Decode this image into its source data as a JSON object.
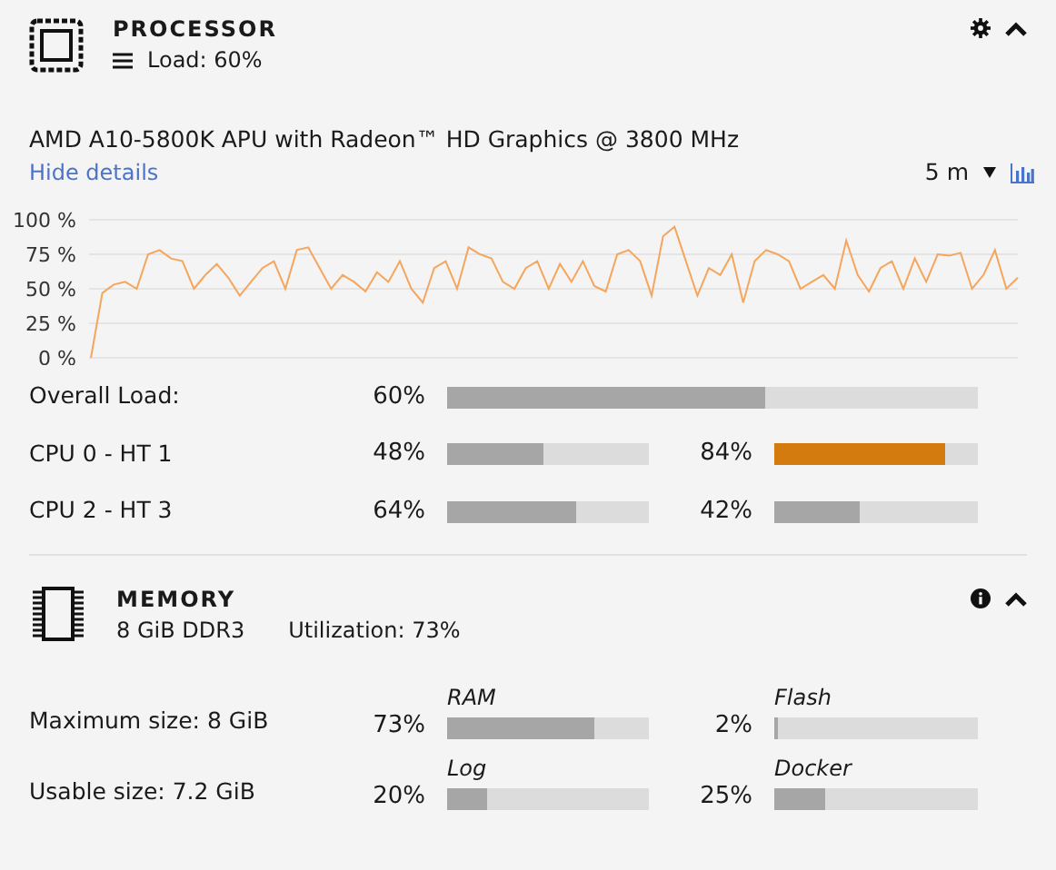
{
  "processor": {
    "title": "PROCESSOR",
    "load": "Load: 60%",
    "model": "AMD A10-5800K APU with Radeon™ HD Graphics @ 3800 MHz",
    "details_link": "Hide details",
    "range": "5 m",
    "chart_data": {
      "type": "line",
      "grid": true,
      "ylim": [
        0,
        100
      ],
      "yticks": [
        {
          "value": 0,
          "label": "0 %"
        },
        {
          "value": 25,
          "label": "25 %"
        },
        {
          "value": 50,
          "label": "50 %"
        },
        {
          "value": 75,
          "label": "75 %"
        },
        {
          "value": 100,
          "label": "100 %"
        }
      ],
      "series": [
        {
          "color": "#f5a55c",
          "values": [
            0,
            47,
            53,
            55,
            50,
            75,
            78,
            72,
            70,
            50,
            60,
            68,
            58,
            45,
            55,
            65,
            70,
            50,
            78,
            80,
            65,
            50,
            60,
            55,
            48,
            62,
            55,
            70,
            50,
            40,
            65,
            70,
            50,
            80,
            75,
            72,
            55,
            50,
            65,
            70,
            50,
            68,
            55,
            70,
            52,
            48,
            75,
            78,
            70,
            45,
            88,
            95,
            70,
            45,
            65,
            60,
            75,
            40,
            70,
            78,
            75,
            70,
            50,
            55,
            60,
            50,
            85,
            60,
            48,
            65,
            70,
            50,
            72,
            55,
            75,
            74,
            76,
            50,
            60,
            78,
            50,
            58
          ]
        }
      ]
    },
    "rows": [
      {
        "label": "Overall Load:",
        "kind": "wide",
        "bars": [
          {
            "reading": "60%",
            "level": 0.6,
            "color": "#a6a6a6"
          }
        ]
      },
      {
        "label": "CPU 0 - HT 1",
        "kind": "pair",
        "bars": [
          {
            "reading": "48%",
            "level": 0.48,
            "color": "#a6a6a6"
          },
          {
            "reading": "84%",
            "level": 0.84,
            "color": "#d47b10"
          }
        ]
      },
      {
        "label": "CPU 2 - HT 3",
        "kind": "pair",
        "bars": [
          {
            "reading": "64%",
            "level": 0.64,
            "color": "#a6a6a6"
          },
          {
            "reading": "42%",
            "level": 0.42,
            "color": "#a6a6a6"
          }
        ]
      }
    ]
  },
  "memory": {
    "title": "MEMORY",
    "type": "8 GiB DDR3",
    "utilization": "Utilization: 73%",
    "rows": [
      {
        "label": "Maximum size: 8 GiB",
        "bars": [
          {
            "name": "RAM",
            "reading": "73%",
            "level": 0.73
          },
          {
            "name": "Flash",
            "reading": "2%",
            "level": 0.02
          }
        ]
      },
      {
        "label": "Usable size: 7.2 GiB",
        "bars": [
          {
            "name": "Log",
            "reading": "20%",
            "level": 0.2
          },
          {
            "name": "Docker",
            "reading": "25%",
            "level": 0.25
          }
        ]
      }
    ]
  }
}
